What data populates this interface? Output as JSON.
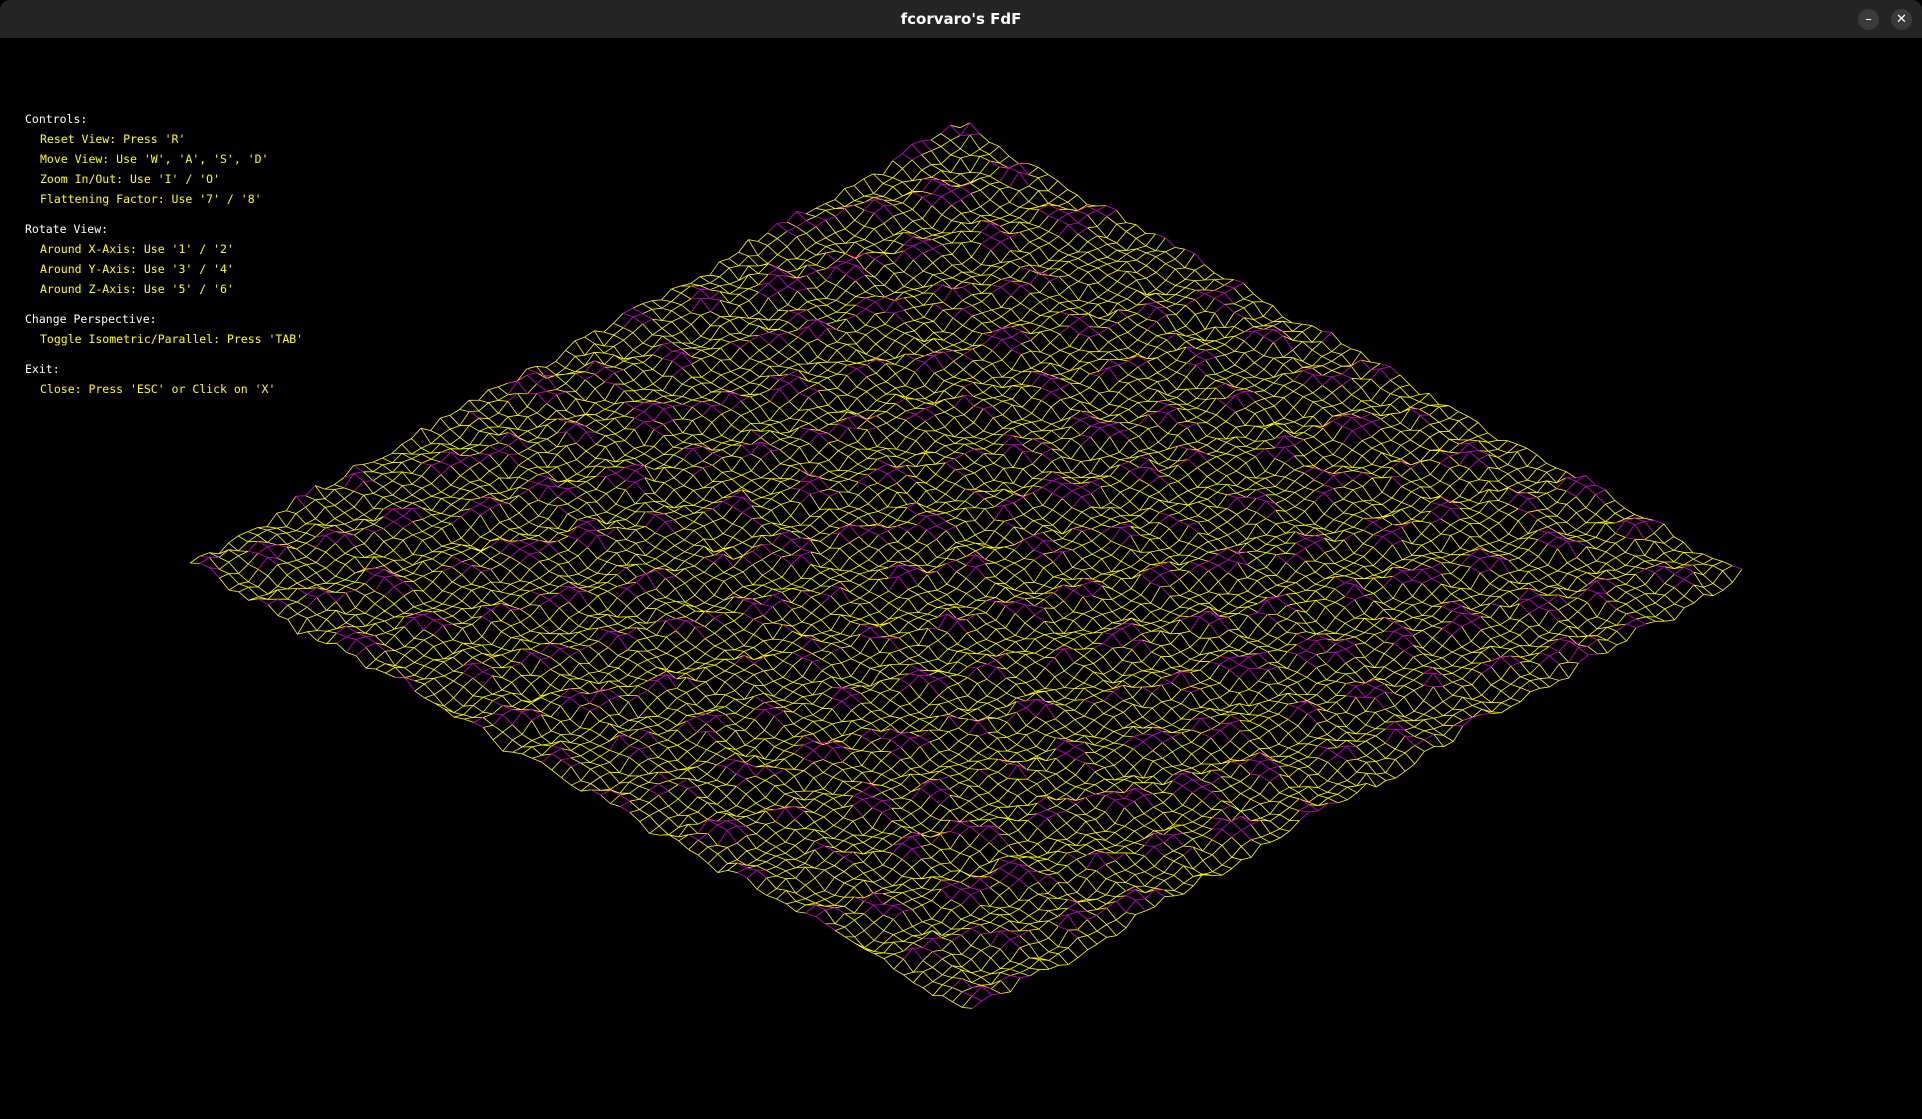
{
  "window": {
    "title": "fcorvaro's FdF",
    "minimize_glyph": "–",
    "close_glyph": "✕",
    "minimize_icon": "minimize-icon",
    "close_icon": "close-icon"
  },
  "controls": {
    "sections": [
      {
        "heading": "Controls:",
        "items": [
          "Reset View: Press 'R'",
          "Move View: Use 'W', 'A', 'S', 'D'",
          "Zoom In/Out: Use 'I' / 'O'",
          "Flattening Factor: Use '7' / '8'"
        ]
      },
      {
        "heading": "Rotate View:",
        "items": [
          "Around X-Axis: Use '1' / '2'",
          "Around Y-Axis: Use '3' / '4'",
          "Around Z-Axis: Use '5' / '6'"
        ]
      },
      {
        "heading": "Change Perspective:",
        "items": [
          "Toggle Isometric/Parallel: Press 'TAB'"
        ]
      },
      {
        "heading": "Exit:",
        "items": [
          "Close: Press 'ESC' or Click on 'X'"
        ]
      }
    ]
  },
  "colors": {
    "background": "#000000",
    "titlebar": "#242424",
    "heading_text": "#ffffff",
    "item_text": "#ffff00",
    "wire_low": "#ffff00",
    "wire_high": "#cc00cc"
  }
}
